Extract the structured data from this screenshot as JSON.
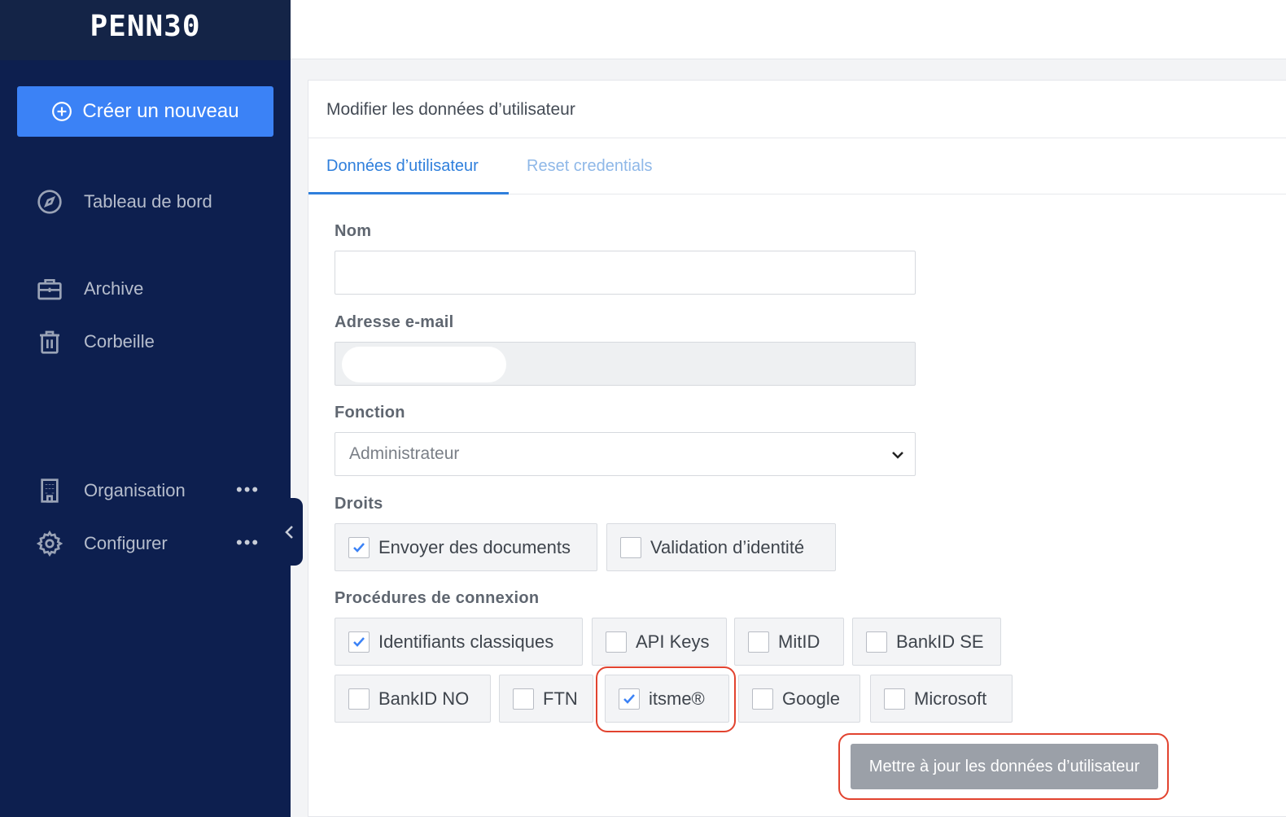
{
  "brand": {
    "logo_text": "PENN30"
  },
  "sidebar": {
    "create_label": "Créer un nouveau",
    "items": [
      {
        "label": "Tableau de bord",
        "icon": "compass-icon"
      },
      {
        "label": "Archive",
        "icon": "briefcase-icon"
      },
      {
        "label": "Corbeille",
        "icon": "trash-icon"
      },
      {
        "label": "Organisation",
        "icon": "building-icon",
        "more": "•••"
      },
      {
        "label": "Configurer",
        "icon": "gear-icon",
        "more": "•••"
      }
    ]
  },
  "card": {
    "title": "Modifier les données d’utilisateur",
    "tabs": [
      {
        "label": "Données d’utilisateur",
        "active": true
      },
      {
        "label": "Reset credentials",
        "active": false
      }
    ]
  },
  "form": {
    "name": {
      "label": "Nom",
      "value": ""
    },
    "email": {
      "label": "Adresse e-mail",
      "value": ""
    },
    "function": {
      "label": "Fonction",
      "value": "Administrateur"
    },
    "rights": {
      "label": "Droits",
      "options": [
        {
          "label": "Envoyer des documents",
          "checked": true
        },
        {
          "label": "Validation d’identité",
          "checked": false
        }
      ]
    },
    "login_procedures": {
      "label": "Procédures de connexion",
      "options": [
        {
          "label": "Identifiants classiques",
          "checked": true
        },
        {
          "label": "API Keys",
          "checked": false
        },
        {
          "label": "MitID",
          "checked": false
        },
        {
          "label": "BankID SE",
          "checked": false
        },
        {
          "label": "BankID NO",
          "checked": false
        },
        {
          "label": "FTN",
          "checked": false
        },
        {
          "label": "itsme®",
          "checked": true
        },
        {
          "label": "Google",
          "checked": false
        },
        {
          "label": "Microsoft",
          "checked": false
        }
      ]
    },
    "submit_label": "Mettre à jour les données d’utilisateur"
  },
  "colors": {
    "sidebar": "#0d1f4f",
    "accent": "#3b82f6",
    "highlight": "#e2432f"
  }
}
